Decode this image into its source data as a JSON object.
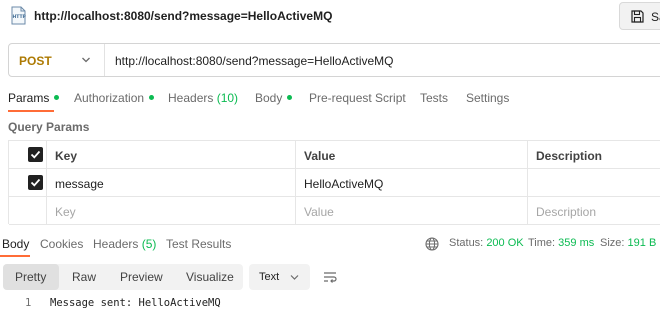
{
  "request": {
    "title": "http://localhost:8080/send?message=HelloActiveMQ",
    "save_label": "Save",
    "method": "POST",
    "url": "http://localhost:8080/send?message=HelloActiveMQ"
  },
  "req_tabs": {
    "params": "Params",
    "authorization": "Authorization",
    "headers": "Headers",
    "headers_count": "(10)",
    "body": "Body",
    "prerequest": "Pre-request Script",
    "tests": "Tests",
    "settings": "Settings"
  },
  "query_params": {
    "section_label": "Query Params",
    "columns": {
      "key": "Key",
      "value": "Value",
      "description": "Description"
    },
    "row": {
      "key": "message",
      "value": "HelloActiveMQ",
      "enabled": true
    },
    "placeholder": {
      "key": "Key",
      "value": "Value",
      "description": "Description"
    }
  },
  "resp_tabs": {
    "body": "Body",
    "cookies": "Cookies",
    "headers": "Headers",
    "headers_count": "(5)",
    "test_results": "Test Results"
  },
  "status": {
    "status_label": "Status:",
    "status_value": "200 OK",
    "time_label": "Time:",
    "time_value": "359 ms",
    "size_label": "Size:",
    "size_value": "191 B"
  },
  "views": {
    "pretty": "Pretty",
    "raw": "Raw",
    "preview": "Preview",
    "visualize": "Visualize",
    "format": "Text"
  },
  "response": {
    "line_number": "1",
    "text": "Message sent: HelloActiveMQ"
  },
  "colors": {
    "accent": "#ff6c37",
    "active_indicator": "#0cbb52",
    "method_post": "#ad7a03"
  },
  "icons": [
    "http-request-icon",
    "save-icon",
    "chevron-down-icon",
    "checkbox-checked-icon",
    "globe-icon",
    "wrap-lines-icon"
  ]
}
